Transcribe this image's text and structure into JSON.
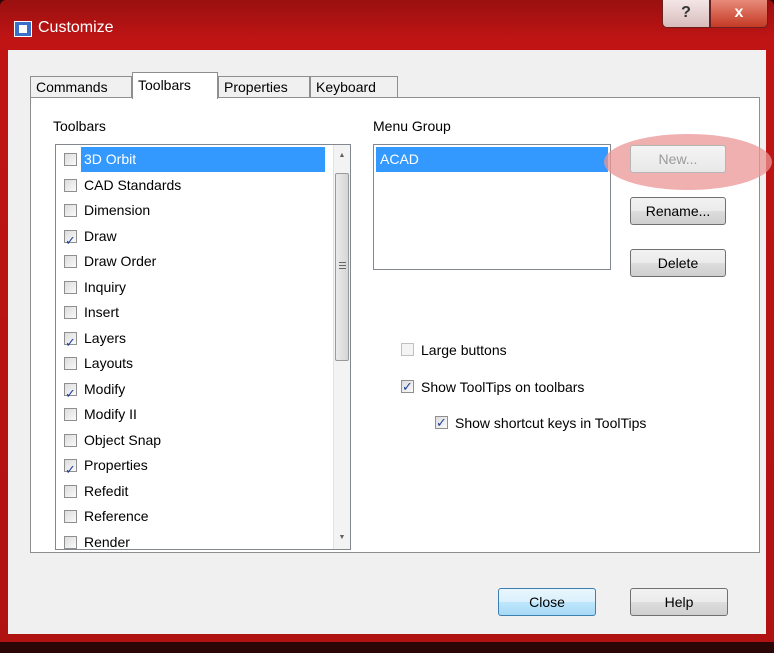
{
  "window": {
    "title": "Customize",
    "help_label": "?",
    "close_label": "x"
  },
  "tabs": [
    "Commands",
    "Toolbars",
    "Properties",
    "Keyboard"
  ],
  "toolbars": {
    "label": "Toolbars",
    "items": [
      {
        "label": "3D Orbit",
        "checked": false,
        "selected": true
      },
      {
        "label": "CAD Standards",
        "checked": false
      },
      {
        "label": "Dimension",
        "checked": false
      },
      {
        "label": "Draw",
        "checked": true
      },
      {
        "label": "Draw Order",
        "checked": false
      },
      {
        "label": "Inquiry",
        "checked": false
      },
      {
        "label": "Insert",
        "checked": false
      },
      {
        "label": "Layers",
        "checked": true
      },
      {
        "label": "Layouts",
        "checked": false
      },
      {
        "label": "Modify",
        "checked": true
      },
      {
        "label": "Modify II",
        "checked": false
      },
      {
        "label": "Object Snap",
        "checked": false
      },
      {
        "label": "Properties",
        "checked": true
      },
      {
        "label": "Refedit",
        "checked": false
      },
      {
        "label": "Reference",
        "checked": false
      },
      {
        "label": "Render",
        "checked": false
      }
    ]
  },
  "menu_group": {
    "label": "Menu Group",
    "items": [
      "ACAD"
    ]
  },
  "buttons": {
    "new": "New...",
    "rename": "Rename...",
    "delete": "Delete",
    "close": "Close",
    "help": "Help"
  },
  "options": {
    "large_buttons": "Large buttons",
    "show_tooltips": "Show ToolTips on toolbars",
    "show_shortcut_keys": "Show shortcut keys in ToolTips"
  }
}
